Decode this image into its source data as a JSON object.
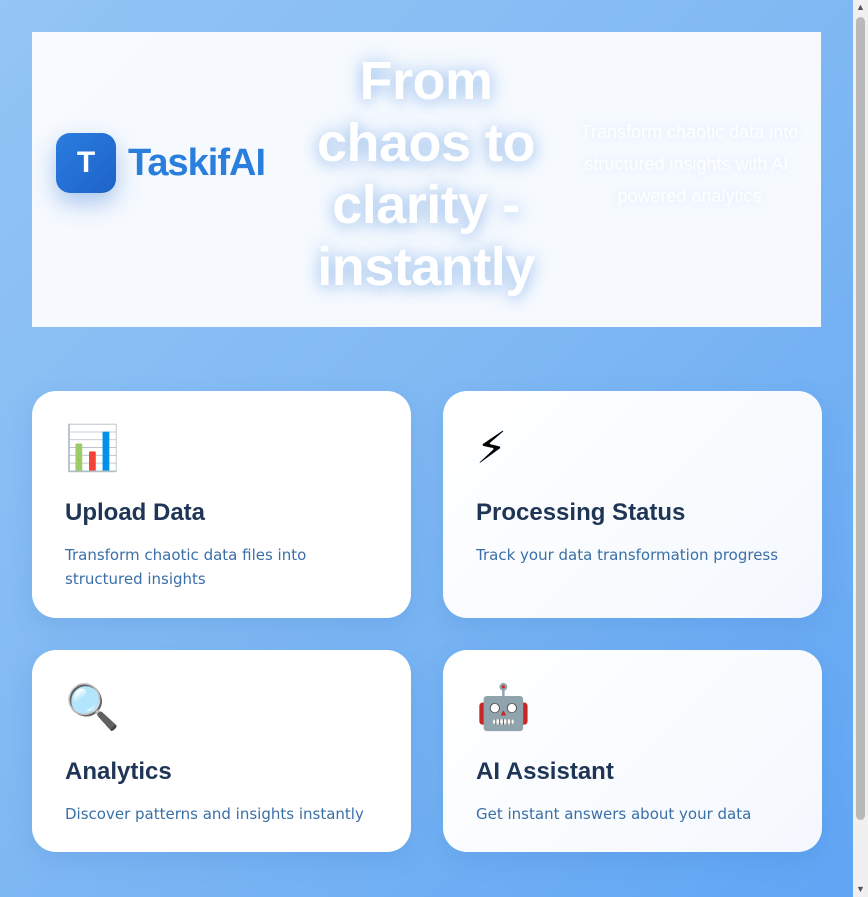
{
  "brand": {
    "logo_letter": "T",
    "name": "TaskifAI"
  },
  "hero": {
    "title": "From chaos to clarity - instantly",
    "subtitle": "Transform chaotic data into structured insights with AI-powered analytics"
  },
  "cards": [
    {
      "icon": "📊",
      "icon_name": "bar-chart-icon",
      "title": "Upload Data",
      "description": "Transform chaotic data files into structured insights"
    },
    {
      "icon": "⚡",
      "icon_name": "lightning-icon",
      "title": "Processing Status",
      "description": "Track your data transformation progress"
    },
    {
      "icon": "🔍",
      "icon_name": "magnifier-icon",
      "title": "Analytics",
      "description": "Discover patterns and insights instantly"
    },
    {
      "icon": "🤖",
      "icon_name": "robot-icon",
      "title": "AI Assistant",
      "description": "Get instant answers about your data"
    }
  ],
  "scrollbar": {
    "up_arrow": "▲",
    "down_arrow": "▼"
  },
  "colors": {
    "brand": "#2a7fdc",
    "card_title": "#1f3556",
    "card_desc": "#3a6fa8"
  }
}
